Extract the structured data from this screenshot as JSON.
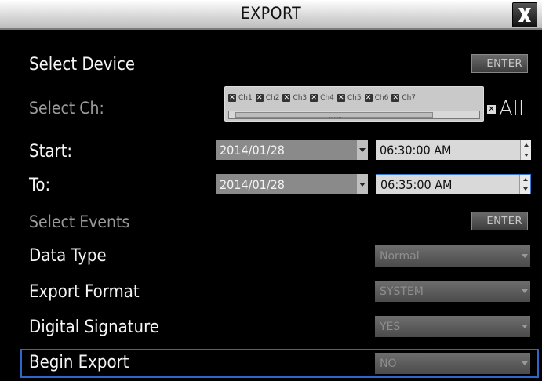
{
  "window": {
    "title": "EXPORT",
    "close_icon": "close-x-icon"
  },
  "select_device": {
    "label": "Select Device",
    "button": "ENTER"
  },
  "select_channel": {
    "label": "Select Ch:",
    "channels": [
      "Ch1",
      "Ch2",
      "Ch3",
      "Ch4",
      "Ch5",
      "Ch6",
      "Ch7"
    ],
    "all_label": "All"
  },
  "start": {
    "label": "Start:",
    "date": "2014/01/28",
    "time": "06:30:00 AM"
  },
  "to": {
    "label": "To:",
    "date": "2014/01/28",
    "time": "06:35:00 AM"
  },
  "select_events": {
    "label": "Select Events",
    "button": "ENTER"
  },
  "data_type": {
    "label": "Data Type",
    "value": "Normal"
  },
  "export_format": {
    "label": "Export Format",
    "value": "SYSTEM"
  },
  "digital_signature": {
    "label": "Digital Signature",
    "value": "YES"
  },
  "begin_export": {
    "label": "Begin Export",
    "value": "NO"
  },
  "colors": {
    "accent": "#2f67c9",
    "background": "#000000",
    "titlebar": "#d9d9d9"
  }
}
